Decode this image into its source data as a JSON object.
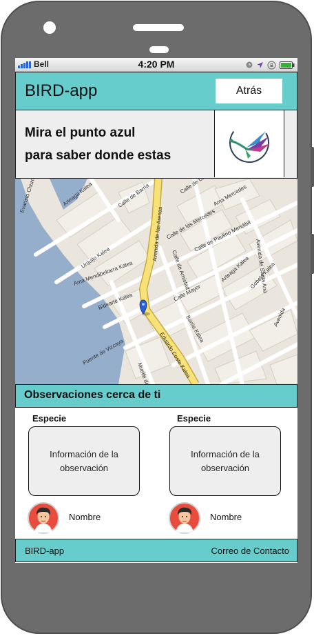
{
  "status_bar": {
    "carrier": "Bell",
    "time": "4:20 PM"
  },
  "header": {
    "title": "BIRD-app",
    "back_label": "Atrás"
  },
  "info": {
    "line1": "Mira el punto azul",
    "line2": "para saber donde estas"
  },
  "map": {
    "street_labels": [
      "Evaristo Churruca",
      "Arteaga Kalea",
      "Calle de Barria",
      "Calle de Urquijo",
      "Avenida de las Arenas",
      "Calle de las Mercedes",
      "Ama Mercedes",
      "Calle de Paulino Mendibil",
      "Urquijo Kalea",
      "Ama Mendibeltarra Kalea",
      "Calle de Amistad",
      "Calle Mayor",
      "Avenida de Santa Ana",
      "Arteaga Kalea",
      "Gobela Kalea",
      "Barria Kalea",
      "Eduardo Coste Kalea",
      "Puente de Vizcaya",
      "Muelle de",
      "Bidearte Kalea",
      "Avenida"
    ]
  },
  "observations": {
    "title": "Observaciones cerca de ti",
    "items": [
      {
        "species": "Especie",
        "info": "Información de la observación",
        "name": "Nombre"
      },
      {
        "species": "Especie",
        "info": "Información de la observación",
        "name": "Nombre"
      }
    ]
  },
  "footer": {
    "left": "BIRD-app",
    "right": "Correo de Contacto"
  },
  "colors": {
    "accent": "#66cccc",
    "panel": "#eeeeee",
    "avatar_bg": "#e84c3d",
    "location_pin": "#2a5fd6"
  },
  "icons": [
    "signal-icon",
    "clock-icon",
    "location-arrow-icon",
    "lock-rotation-icon",
    "battery-icon",
    "bird-logo-icon",
    "location-pin-icon",
    "user-avatar-icon"
  ]
}
